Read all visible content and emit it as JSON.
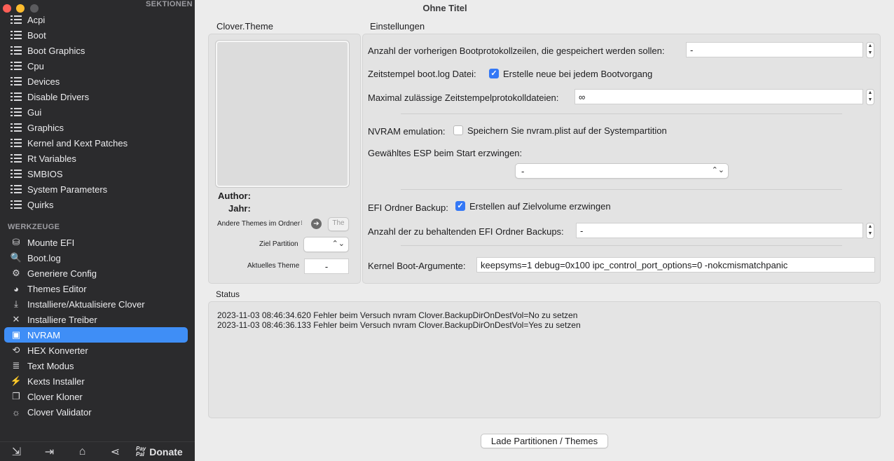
{
  "sidebar": {
    "sections_title": "SEKTIONEN",
    "sections": [
      {
        "label": "Acpi",
        "icon": "list-icon"
      },
      {
        "label": "Boot",
        "icon": "list-icon"
      },
      {
        "label": "Boot Graphics",
        "icon": "list-icon"
      },
      {
        "label": "Cpu",
        "icon": "list-icon"
      },
      {
        "label": "Devices",
        "icon": "list-icon"
      },
      {
        "label": "Disable Drivers",
        "icon": "list-icon"
      },
      {
        "label": "Gui",
        "icon": "list-icon"
      },
      {
        "label": "Graphics",
        "icon": "list-icon"
      },
      {
        "label": "Kernel and Kext Patches",
        "icon": "list-icon"
      },
      {
        "label": "Rt Variables",
        "icon": "list-icon"
      },
      {
        "label": "SMBIOS",
        "icon": "list-icon"
      },
      {
        "label": "System Parameters",
        "icon": "list-icon"
      },
      {
        "label": "Quirks",
        "icon": "list-icon"
      }
    ],
    "tools_title": "WERKZEUGE",
    "tools": [
      {
        "label": "Mounte EFI",
        "icon": "disk-icon",
        "glyph": "⛁"
      },
      {
        "label": "Boot.log",
        "icon": "log-search-icon",
        "glyph": "🔍"
      },
      {
        "label": "Generiere Config",
        "icon": "gears-icon",
        "glyph": "⚙"
      },
      {
        "label": "Themes Editor",
        "icon": "palette-icon",
        "glyph": "◕"
      },
      {
        "label": "Installiere/Aktualisiere Clover",
        "icon": "download-icon",
        "glyph": "⤓"
      },
      {
        "label": "Installiere Treiber",
        "icon": "tools-icon",
        "glyph": "✕"
      },
      {
        "label": "NVRAM",
        "icon": "chip-icon",
        "glyph": "▣"
      },
      {
        "label": "HEX Konverter",
        "icon": "convert-icon",
        "glyph": "⟲"
      },
      {
        "label": "Text Modus",
        "icon": "text-lines-icon",
        "glyph": "≣"
      },
      {
        "label": "Kexts Installer",
        "icon": "plug-icon",
        "glyph": "⚡"
      },
      {
        "label": "Clover Kloner",
        "icon": "clone-icon",
        "glyph": "❐"
      },
      {
        "label": "Clover Validator",
        "icon": "lightbulb-icon",
        "glyph": "☼"
      }
    ],
    "active_tool": "NVRAM",
    "bottom": {
      "donate_label": "Donate",
      "paypal_line1": "Pay",
      "paypal_line2": "Pal"
    }
  },
  "main": {
    "window_title": "Ohne Titel",
    "theme_panel": {
      "title": "Clover.Theme",
      "author_label": "Author:",
      "year_label": "Jahr:",
      "other_themes_label": "Andere Themes im Ordner",
      "other_themes_button": "The",
      "target_partition_label": "Ziel Partition",
      "current_theme_label": "Aktuelles Theme",
      "current_theme_value": "-"
    },
    "settings": {
      "title": "Einstellungen",
      "bootlog_lines_label": "Anzahl der vorherigen Bootprotokollzeilen, die gespeichert werden sollen:",
      "bootlog_lines_value": "-",
      "timestamp_label": "Zeitstempel boot.log Datei:",
      "timestamp_checkbox_label": "Erstelle neue bei jedem Bootvorgang",
      "timestamp_checked": true,
      "max_timestamp_label": "Maximal zulässige Zeitstempelprotokolldateien:",
      "max_timestamp_value": "∞",
      "nvram_emulation_label": "NVRAM emulation:",
      "nvram_emulation_checkbox_label": "Speichern Sie nvram.plist auf der Systempartition",
      "nvram_emulation_checked": false,
      "esp_label": "Gewähltes ESP beim Start erzwingen:",
      "esp_value": "-",
      "efi_backup_label": "EFI Ordner Backup:",
      "efi_backup_checkbox_label": "Erstellen auf Zielvolume erzwingen",
      "efi_backup_checked": true,
      "efi_keep_label": "Anzahl der zu behaltenden EFI Ordner Backups:",
      "efi_keep_value": "-",
      "kernel_args_label": "Kernel Boot-Argumente:",
      "kernel_args_value": "keepsyms=1 debug=0x100 ipc_control_port_options=0 -nokcmismatchpanic"
    },
    "status": {
      "title": "Status",
      "lines": [
        "2023-11-03 08:46:34.620 Fehler beim Versuch nvram Clover.BackupDirOnDestVol=No zu setzen",
        "2023-11-03 08:46:36.133 Fehler beim Versuch nvram Clover.BackupDirOnDestVol=Yes zu setzen"
      ]
    },
    "load_button": "Lade Partitionen / Themes"
  }
}
